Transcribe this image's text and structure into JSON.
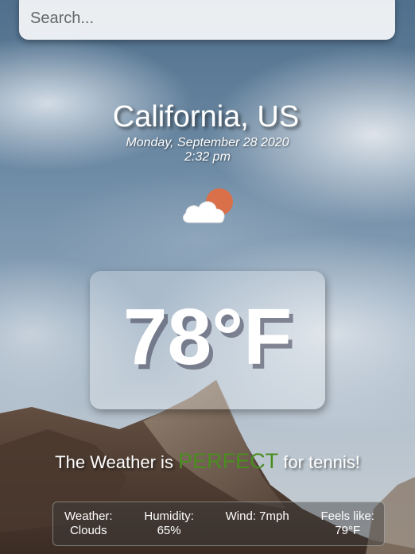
{
  "search": {
    "placeholder": "Search..."
  },
  "location": "California, US",
  "date": "Monday, September 28 2020",
  "time": "2:32 pm",
  "condition_icon": "partly-cloudy-icon",
  "temperature": "78°F",
  "tagline": {
    "prefix": "The Weather is",
    "verdict": "PERFECT",
    "suffix": "for tennis!"
  },
  "colors": {
    "verdict": "#4a8d1f",
    "sun": "#d9704a"
  },
  "stats": {
    "weather": {
      "label": "Weather:",
      "value": "Clouds"
    },
    "humidity": {
      "label": "Humidity:",
      "value": "65%"
    },
    "wind": {
      "label": "Wind: 7mph"
    },
    "feels_like": {
      "label": "Feels like:",
      "value": "79°F"
    }
  }
}
